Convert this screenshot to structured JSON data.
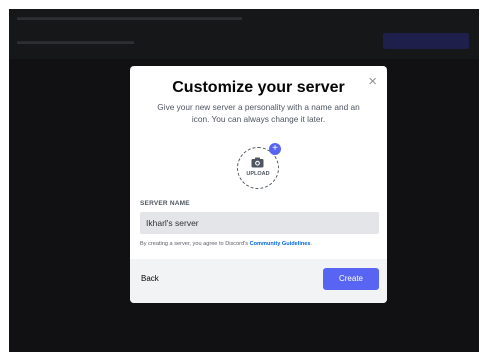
{
  "modal": {
    "title": "Customize your server",
    "subtitle": "Give your new server a personality with a name and an icon. You can always change it later.",
    "upload_label": "UPLOAD",
    "plus_symbol": "+",
    "close_symbol": "×",
    "field_label": "SERVER NAME",
    "server_name_value": "Ikharl's server",
    "terms_prefix": "By creating a server, you agree to Discord's",
    "terms_link": "Community Guidelines",
    "terms_suffix": ".",
    "back_label": "Back",
    "create_label": "Create"
  },
  "icons": {
    "close": "close-icon",
    "camera": "camera-icon",
    "plus": "plus-icon"
  },
  "colors": {
    "brand": "#5865f2",
    "link": "#0068e0",
    "backdrop": "#111113"
  }
}
